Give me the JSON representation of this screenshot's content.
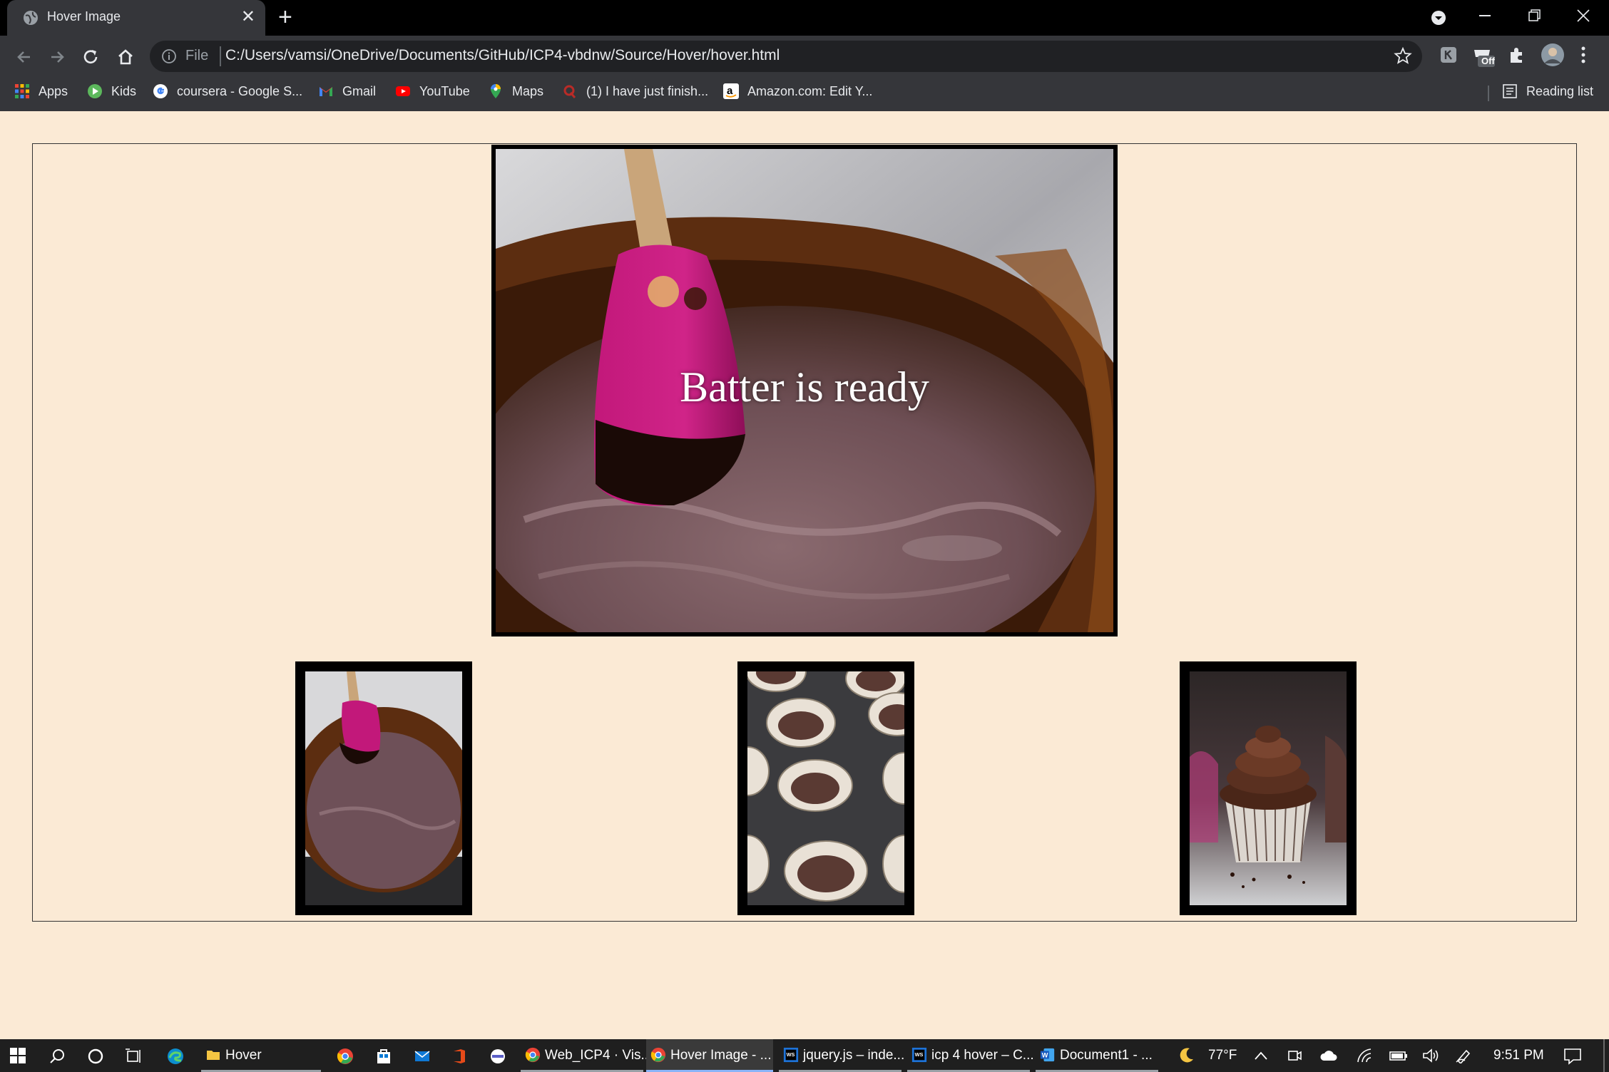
{
  "browser": {
    "tab_title": "Hover Image",
    "tab_close": "✕",
    "new_tab": "+",
    "url_scheme": "File",
    "url": "C:/Users/vamsi/OneDrive/Documents/GitHub/ICP4-vbdnw/Source/Hover/hover.html",
    "bookmarks": [
      {
        "label": "Apps",
        "icon": "apps-grid-icon"
      },
      {
        "label": "Kids",
        "icon": "kids-icon"
      },
      {
        "label": "coursera - Google S...",
        "icon": "google-icon"
      },
      {
        "label": "Gmail",
        "icon": "gmail-icon"
      },
      {
        "label": "YouTube",
        "icon": "youtube-icon"
      },
      {
        "label": "Maps",
        "icon": "maps-icon"
      },
      {
        "label": "(1) I have just finish...",
        "icon": "quora-icon"
      },
      {
        "label": "Amazon.com: Edit Y...",
        "icon": "amazon-icon"
      }
    ],
    "reading_list": "Reading list",
    "ext_badge": "Off"
  },
  "page": {
    "caption": "Batter is ready",
    "thumbnails": [
      {
        "name": "batter-bowl"
      },
      {
        "name": "cupcake-liners-tray"
      },
      {
        "name": "frosted-cupcake"
      }
    ]
  },
  "taskbar": {
    "items": [
      {
        "label": "Hover",
        "icon": "folder-icon"
      },
      {
        "label": "Web_ICP4 · Vis...",
        "icon": "chrome-icon"
      },
      {
        "label": "Hover Image - ...",
        "icon": "chrome-icon"
      },
      {
        "label": "jquery.js – inde...",
        "icon": "webstorm-icon"
      },
      {
        "label": "icp 4 hover – C...",
        "icon": "webstorm-icon"
      },
      {
        "label": "Document1 - ...",
        "icon": "word-icon"
      }
    ],
    "weather": "77°F",
    "time": "9:51 PM"
  }
}
